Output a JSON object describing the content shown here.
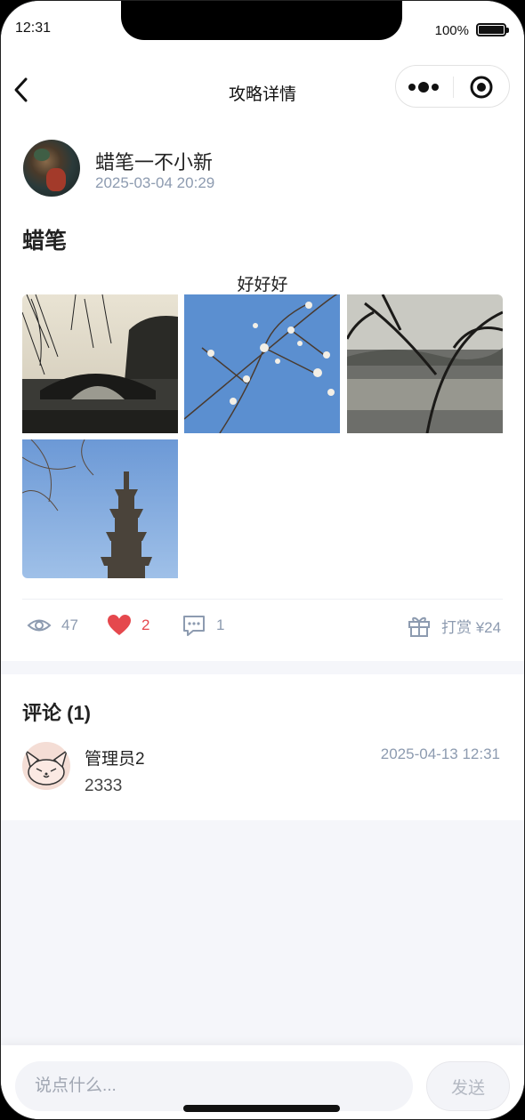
{
  "status_bar": {
    "time": "12:31",
    "battery": "100%"
  },
  "nav": {
    "title": "攻略详情",
    "back_icon": "chevron-left-icon",
    "more_icon": "more-dots-icon",
    "target_icon": "target-icon"
  },
  "post": {
    "author": "蜡笔一不小新",
    "date": "2025-03-04 20:29",
    "title": "蜡笔",
    "body": "好好好",
    "photos": [
      "bridge-photo",
      "magnolia-photo",
      "lake-photo",
      "pagoda-photo"
    ]
  },
  "stats": {
    "views": "47",
    "likes": "2",
    "comments": "1",
    "tip_label": "打赏 ¥24",
    "colors": {
      "muted": "#8d9bb0",
      "like": "#e5484d"
    }
  },
  "comments": {
    "title": "评论 (1)",
    "items": [
      {
        "name": "管理员2",
        "date": "2025-04-13 12:31",
        "text": "2333"
      }
    ]
  },
  "input": {
    "placeholder": "说点什么...",
    "send_label": "发送"
  }
}
